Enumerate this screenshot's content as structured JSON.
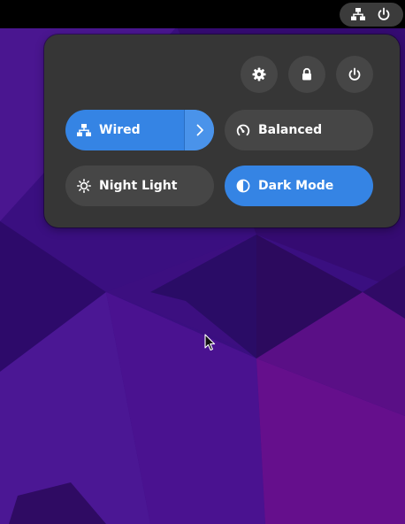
{
  "topbar": {
    "icons": [
      "network-wired-icon",
      "power-icon"
    ]
  },
  "quick_settings": {
    "actions": [
      {
        "name": "settings",
        "icon": "gear-icon"
      },
      {
        "name": "lock",
        "icon": "lock-icon"
      },
      {
        "name": "power",
        "icon": "power-icon"
      }
    ],
    "toggles": {
      "wired": {
        "label": "Wired",
        "icon": "network-wired-icon",
        "active": true,
        "has_menu": true
      },
      "power_mode": {
        "label": "Balanced",
        "icon": "power-mode-gauge-icon",
        "active": false
      },
      "night_light": {
        "label": "Night Light",
        "icon": "sun-icon",
        "active": false
      },
      "dark_mode": {
        "label": "Dark Mode",
        "icon": "dark-mode-icon",
        "active": true
      }
    }
  },
  "colors": {
    "accent": "#3584e4",
    "panel": "#363636",
    "button": "#464646",
    "topbar": "#000000",
    "wallpaper_base": "#3a0f80"
  }
}
